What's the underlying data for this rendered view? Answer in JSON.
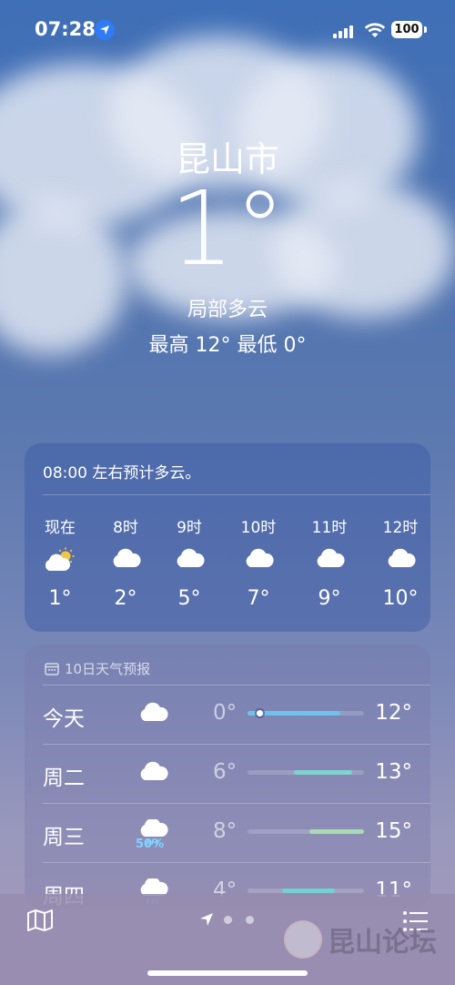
{
  "status_bar": {
    "time": "07:28",
    "battery": "100"
  },
  "header": {
    "city": "昆山市",
    "temperature": "1°",
    "condition": "局部多云",
    "high_low": "最高 12°  最低 0°"
  },
  "hourly": {
    "summary": "08:00 左右预计多云。",
    "items": [
      {
        "label": "现在",
        "icon": "sun-behind-cloud-icon",
        "temp": "1°"
      },
      {
        "label": "8时",
        "icon": "cloud-icon",
        "temp": "2°"
      },
      {
        "label": "9时",
        "icon": "cloud-icon",
        "temp": "5°"
      },
      {
        "label": "10时",
        "icon": "cloud-icon",
        "temp": "7°"
      },
      {
        "label": "11时",
        "icon": "cloud-icon",
        "temp": "9°"
      },
      {
        "label": "12时",
        "icon": "cloud-icon",
        "temp": "10°"
      }
    ]
  },
  "forecast": {
    "title": "10日天气预报",
    "days": [
      {
        "day": "今天",
        "icon": "cloud-icon",
        "precip": "",
        "low": "0°",
        "high": "12°",
        "range_start": 0.0,
        "range_end": 0.8,
        "color": "#6ec3ea",
        "current_marker": true
      },
      {
        "day": "周二",
        "icon": "cloud-icon",
        "precip": "",
        "low": "6°",
        "high": "13°",
        "range_start": 0.4,
        "range_end": 0.9,
        "color": "#7dd4d0",
        "current_marker": false
      },
      {
        "day": "周三",
        "icon": "cloud-rain-icon",
        "precip": "50%",
        "low": "8°",
        "high": "15°",
        "range_start": 0.53,
        "range_end": 1.0,
        "color": "#a6dcb0",
        "current_marker": false
      },
      {
        "day": "周四",
        "icon": "cloud-rain-icon",
        "precip": "",
        "low": "4°",
        "high": "11°",
        "range_start": 0.3,
        "range_end": 0.75,
        "color": "#74d2d6",
        "current_marker": false
      }
    ]
  },
  "tab_bar": {
    "icons": [
      "map-icon",
      "location-arrow-icon",
      "page-dot",
      "page-dot",
      "list-icon"
    ]
  },
  "watermark": {
    "text": "昆山论坛"
  }
}
